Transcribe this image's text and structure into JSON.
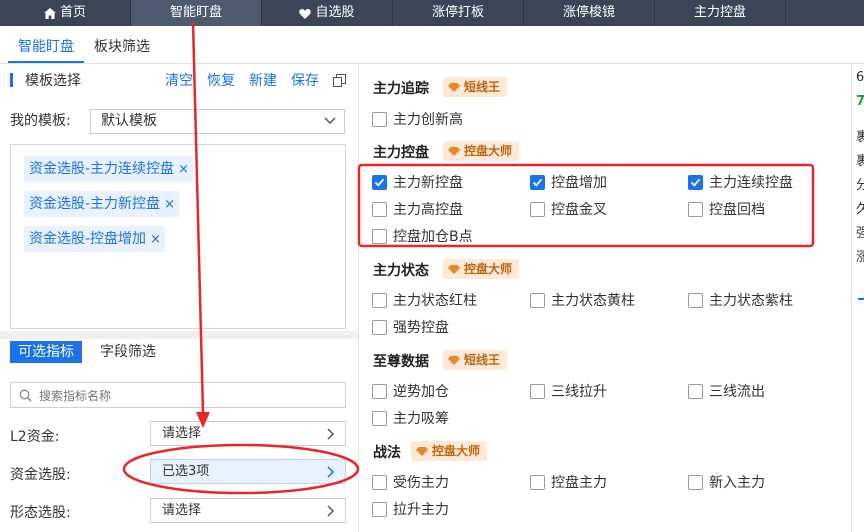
{
  "topnav": {
    "tabs": [
      {
        "label": "首页",
        "icon": "home-icon"
      },
      {
        "label": "智能盯盘"
      },
      {
        "label": "自选股",
        "icon": "heart-icon"
      },
      {
        "label": "涨停打板"
      },
      {
        "label": "涨停梭镜"
      },
      {
        "label": "主力控盘"
      }
    ]
  },
  "subtabs": [
    "智能盯盘",
    "板块筛选"
  ],
  "left": {
    "section_title": "模板选择",
    "actions": [
      "清空",
      "恢复",
      "新建",
      "保存"
    ],
    "my_template_label": "我的模板:",
    "template_value": "默认模板",
    "tags": [
      "资金选股-主力连续控盘",
      "资金选股-主力新控盘",
      "资金选股-控盘增加"
    ],
    "tag_close": "×",
    "filter_tabs": [
      "可选指标",
      "字段筛选"
    ],
    "search_placeholder": "搜索指标名称",
    "rows": [
      {
        "label": "L2资金:",
        "value": "请选择"
      },
      {
        "label": "资金选股:",
        "value": "已选3项"
      },
      {
        "label": "形态选股:",
        "value": "请选择"
      }
    ]
  },
  "groups": [
    {
      "title": "主力追踪",
      "badge": "短线王",
      "items": [
        {
          "label": "主力创新高",
          "checked": false
        }
      ]
    },
    {
      "title": "主力控盘",
      "badge": "控盘大师",
      "items": [
        {
          "label": "主力新控盘",
          "checked": true
        },
        {
          "label": "控盘增加",
          "checked": true
        },
        {
          "label": "主力连续控盘",
          "checked": true
        },
        {
          "label": "主力高控盘",
          "checked": false
        },
        {
          "label": "控盘金叉",
          "checked": false
        },
        {
          "label": "控盘回档",
          "checked": false
        },
        {
          "label": "控盘加仓B点",
          "checked": false
        }
      ]
    },
    {
      "title": "主力状态",
      "badge": "控盘大师",
      "items": [
        {
          "label": "主力状态红柱",
          "checked": false
        },
        {
          "label": "主力状态黄柱",
          "checked": false
        },
        {
          "label": "主力状态紫柱",
          "checked": false
        },
        {
          "label": "强势控盘",
          "checked": false
        }
      ]
    },
    {
      "title": "至尊数据",
      "badge": "短线王",
      "items": [
        {
          "label": "逆势加仓",
          "checked": false
        },
        {
          "label": "三线拉升",
          "checked": false
        },
        {
          "label": "三线流出",
          "checked": false
        },
        {
          "label": "主力吸筹",
          "checked": false
        }
      ]
    },
    {
      "title": "战法",
      "badge": "控盘大师",
      "items": [
        {
          "label": "受伤主力",
          "checked": false
        },
        {
          "label": "控盘主力",
          "checked": false
        },
        {
          "label": "新入主力",
          "checked": false
        },
        {
          "label": "拉升主力",
          "checked": false
        }
      ]
    }
  ],
  "right_cut": [
    "6",
    "7",
    "裹",
    "裹",
    "分",
    "久",
    "强",
    "涨"
  ],
  "colors": {
    "accent": "#1a73e8",
    "nav_bg": "#3a4557",
    "badge_bg": "#fde9d7",
    "badge_fg": "#c2640f",
    "annotation": "#e8262b"
  }
}
